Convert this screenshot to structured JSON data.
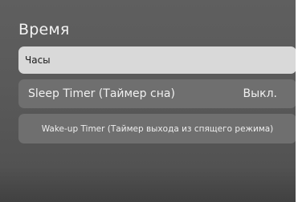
{
  "screen": {
    "title": "Время"
  },
  "menu": {
    "items": [
      {
        "label": "Часы",
        "selected": true
      },
      {
        "label": "Sleep Timer (Таймер сна)",
        "value": "Выкл."
      },
      {
        "label": "Wake-up Timer (Таймер выхода из спящего режима)"
      }
    ]
  },
  "colors": {
    "background": "#5a5a5a",
    "selected_item": "#d9d9d9",
    "item": "#6f6f6f"
  }
}
